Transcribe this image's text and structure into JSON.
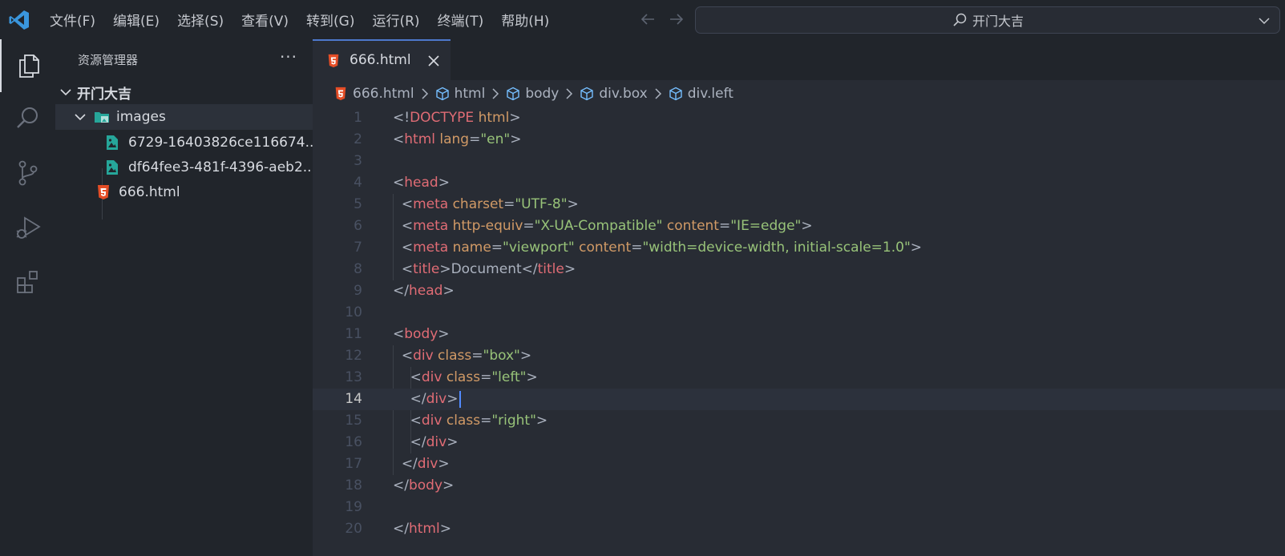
{
  "titlebar": {
    "menus": [
      "文件(F)",
      "编辑(E)",
      "选择(S)",
      "查看(V)",
      "转到(G)",
      "运行(R)",
      "终端(T)",
      "帮助(H)"
    ],
    "search_text": "开门大吉"
  },
  "activitybar": {
    "items": [
      {
        "icon": "explorer-icon",
        "active": true
      },
      {
        "icon": "search-icon",
        "active": false
      },
      {
        "icon": "source-control-icon",
        "active": false
      },
      {
        "icon": "run-debug-icon",
        "active": false
      },
      {
        "icon": "extensions-icon",
        "active": false
      }
    ]
  },
  "sidebar": {
    "title": "资源管理器",
    "more": "···",
    "tree": {
      "root": "开门大吉",
      "folder": "images",
      "files_in_folder": [
        "6729-16403826ce116674...",
        "df64fee3-481f-4396-aeb2..."
      ],
      "root_file": "666.html"
    }
  },
  "editor": {
    "tab_label": "666.html",
    "breadcrumb": [
      "666.html",
      "html",
      "body",
      "div.box",
      "div.left"
    ],
    "current_line": 14,
    "lines": [
      {
        "n": "1",
        "tokens": [
          [
            "p",
            "<!"
          ],
          [
            "t",
            "DOCTYPE"
          ],
          [
            "a",
            " html"
          ],
          [
            "p",
            ">"
          ]
        ]
      },
      {
        "n": "2",
        "tokens": [
          [
            "p",
            "<"
          ],
          [
            "t",
            "html"
          ],
          [
            "a",
            " lang"
          ],
          [
            "p",
            "="
          ],
          [
            "s",
            "\"en\""
          ],
          [
            "p",
            ">"
          ]
        ]
      },
      {
        "n": "3",
        "tokens": []
      },
      {
        "n": "4",
        "tokens": [
          [
            "p",
            "<"
          ],
          [
            "t",
            "head"
          ],
          [
            "p",
            ">"
          ]
        ]
      },
      {
        "n": "5",
        "tokens": [
          [
            "x",
            "  "
          ],
          [
            "p",
            "<"
          ],
          [
            "t",
            "meta"
          ],
          [
            "a",
            " charset"
          ],
          [
            "p",
            "="
          ],
          [
            "s",
            "\"UTF-8\""
          ],
          [
            "p",
            ">"
          ]
        ]
      },
      {
        "n": "6",
        "tokens": [
          [
            "x",
            "  "
          ],
          [
            "p",
            "<"
          ],
          [
            "t",
            "meta"
          ],
          [
            "a",
            " http-equiv"
          ],
          [
            "p",
            "="
          ],
          [
            "s",
            "\"X-UA-Compatible\""
          ],
          [
            "a",
            " content"
          ],
          [
            "p",
            "="
          ],
          [
            "s",
            "\"IE=edge\""
          ],
          [
            "p",
            ">"
          ]
        ]
      },
      {
        "n": "7",
        "tokens": [
          [
            "x",
            "  "
          ],
          [
            "p",
            "<"
          ],
          [
            "t",
            "meta"
          ],
          [
            "a",
            " name"
          ],
          [
            "p",
            "="
          ],
          [
            "s",
            "\"viewport\""
          ],
          [
            "a",
            " content"
          ],
          [
            "p",
            "="
          ],
          [
            "s",
            "\"width=device-width, initial-scale=1.0\""
          ],
          [
            "p",
            ">"
          ]
        ]
      },
      {
        "n": "8",
        "tokens": [
          [
            "x",
            "  "
          ],
          [
            "p",
            "<"
          ],
          [
            "t",
            "title"
          ],
          [
            "p",
            ">"
          ],
          [
            "x",
            "Document"
          ],
          [
            "p",
            "</"
          ],
          [
            "t",
            "title"
          ],
          [
            "p",
            ">"
          ]
        ]
      },
      {
        "n": "9",
        "tokens": [
          [
            "p",
            "</"
          ],
          [
            "t",
            "head"
          ],
          [
            "p",
            ">"
          ]
        ]
      },
      {
        "n": "10",
        "tokens": []
      },
      {
        "n": "11",
        "tokens": [
          [
            "p",
            "<"
          ],
          [
            "t",
            "body"
          ],
          [
            "p",
            ">"
          ]
        ]
      },
      {
        "n": "12",
        "tokens": [
          [
            "x",
            "  "
          ],
          [
            "p",
            "<"
          ],
          [
            "t",
            "div"
          ],
          [
            "a",
            " class"
          ],
          [
            "p",
            "="
          ],
          [
            "s",
            "\"box\""
          ],
          [
            "p",
            ">"
          ]
        ]
      },
      {
        "n": "13",
        "tokens": [
          [
            "x",
            "    "
          ],
          [
            "p",
            "<"
          ],
          [
            "t",
            "div"
          ],
          [
            "a",
            " class"
          ],
          [
            "p",
            "="
          ],
          [
            "s",
            "\"left\""
          ],
          [
            "p",
            ">"
          ]
        ]
      },
      {
        "n": "14",
        "tokens": [
          [
            "x",
            "    "
          ],
          [
            "p",
            "</"
          ],
          [
            "t",
            "div"
          ],
          [
            "p",
            ">"
          ]
        ]
      },
      {
        "n": "15",
        "tokens": [
          [
            "x",
            "    "
          ],
          [
            "p",
            "<"
          ],
          [
            "t",
            "div"
          ],
          [
            "a",
            " class"
          ],
          [
            "p",
            "="
          ],
          [
            "s",
            "\"right\""
          ],
          [
            "p",
            ">"
          ]
        ]
      },
      {
        "n": "16",
        "tokens": [
          [
            "x",
            "    "
          ],
          [
            "p",
            "</"
          ],
          [
            "t",
            "div"
          ],
          [
            "p",
            ">"
          ]
        ]
      },
      {
        "n": "17",
        "tokens": [
          [
            "x",
            "  "
          ],
          [
            "p",
            "</"
          ],
          [
            "t",
            "div"
          ],
          [
            "p",
            ">"
          ]
        ]
      },
      {
        "n": "18",
        "tokens": [
          [
            "p",
            "</"
          ],
          [
            "t",
            "body"
          ],
          [
            "p",
            ">"
          ]
        ]
      },
      {
        "n": "19",
        "tokens": []
      },
      {
        "n": "20",
        "tokens": [
          [
            "p",
            "</"
          ],
          [
            "t",
            "html"
          ],
          [
            "p",
            ">"
          ]
        ]
      }
    ]
  },
  "colors": {
    "accent": "#4d78cc",
    "tag": "#e06c75",
    "attribute": "#d19a66",
    "string": "#98c379",
    "html_file_icon": "#e44d26",
    "image_file_icon": "#26a69a"
  }
}
